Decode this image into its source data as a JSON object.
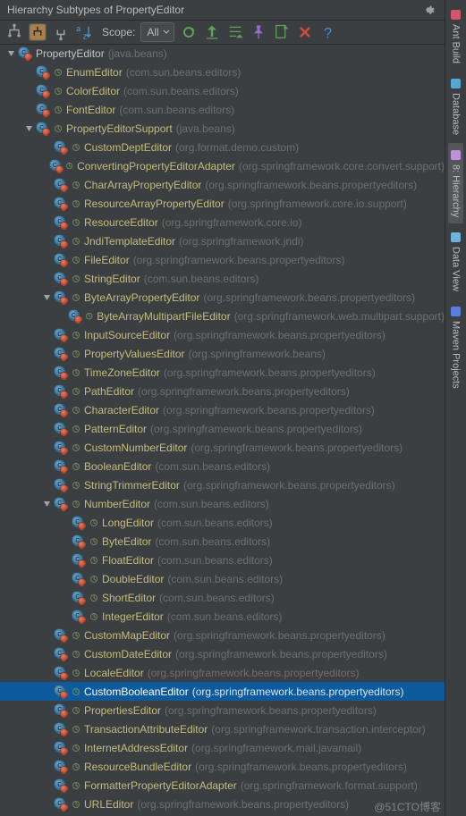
{
  "header": {
    "title": "Hierarchy Subtypes of PropertyEditor"
  },
  "toolbar": {
    "scope_label": "Scope:",
    "scope_value": "All"
  },
  "right_strip": {
    "tabs": [
      {
        "label": "Ant Build",
        "color": "#d2576d"
      },
      {
        "label": "Database",
        "color": "#57a8d8"
      },
      {
        "label": "8: Hierarchy",
        "color": "#c28fdc",
        "hl": true
      },
      {
        "label": "Data View",
        "color": "#6fb2de"
      },
      {
        "label": "Maven Projects",
        "color": "#5a7fe0"
      }
    ]
  },
  "tree": {
    "rows": [
      {
        "d": 0,
        "arrow": "down",
        "root": true,
        "name": "PropertyEditor",
        "pkg": "(java.beans)"
      },
      {
        "d": 1,
        "name": "EnumEditor",
        "pkg": "(com.sun.beans.editors)"
      },
      {
        "d": 1,
        "name": "ColorEditor",
        "pkg": "(com.sun.beans.editors)"
      },
      {
        "d": 1,
        "name": "FontEditor",
        "pkg": "(com.sun.beans.editors)"
      },
      {
        "d": 1,
        "arrow": "down",
        "name": "PropertyEditorSupport",
        "pkg": "(java.beans)"
      },
      {
        "d": 2,
        "name": "CustomDeptEditor",
        "pkg": "(org.format.demo.custom)"
      },
      {
        "d": 2,
        "name": "ConvertingPropertyEditorAdapter",
        "pkg": "(org.springframework.core.convert.support)"
      },
      {
        "d": 2,
        "name": "CharArrayPropertyEditor",
        "pkg": "(org.springframework.beans.propertyeditors)"
      },
      {
        "d": 2,
        "name": "ResourceArrayPropertyEditor",
        "pkg": "(org.springframework.core.io.support)"
      },
      {
        "d": 2,
        "name": "ResourceEditor",
        "pkg": "(org.springframework.core.io)"
      },
      {
        "d": 2,
        "name": "JndiTemplateEditor",
        "pkg": "(org.springframework.jndi)"
      },
      {
        "d": 2,
        "name": "FileEditor",
        "pkg": "(org.springframework.beans.propertyeditors)"
      },
      {
        "d": 2,
        "name": "StringEditor",
        "pkg": "(com.sun.beans.editors)"
      },
      {
        "d": 2,
        "arrow": "down",
        "name": "ByteArrayPropertyEditor",
        "pkg": "(org.springframework.beans.propertyeditors)"
      },
      {
        "d": 3,
        "name": "ByteArrayMultipartFileEditor",
        "pkg": "(org.springframework.web.multipart.support)"
      },
      {
        "d": 2,
        "name": "InputSourceEditor",
        "pkg": "(org.springframework.beans.propertyeditors)"
      },
      {
        "d": 2,
        "name": "PropertyValuesEditor",
        "pkg": "(org.springframework.beans)"
      },
      {
        "d": 2,
        "name": "TimeZoneEditor",
        "pkg": "(org.springframework.beans.propertyeditors)"
      },
      {
        "d": 2,
        "name": "PathEditor",
        "pkg": "(org.springframework.beans.propertyeditors)"
      },
      {
        "d": 2,
        "name": "CharacterEditor",
        "pkg": "(org.springframework.beans.propertyeditors)"
      },
      {
        "d": 2,
        "name": "PatternEditor",
        "pkg": "(org.springframework.beans.propertyeditors)"
      },
      {
        "d": 2,
        "name": "CustomNumberEditor",
        "pkg": "(org.springframework.beans.propertyeditors)"
      },
      {
        "d": 2,
        "name": "BooleanEditor",
        "pkg": "(com.sun.beans.editors)"
      },
      {
        "d": 2,
        "name": "StringTrimmerEditor",
        "pkg": "(org.springframework.beans.propertyeditors)"
      },
      {
        "d": 2,
        "arrow": "down",
        "name": "NumberEditor",
        "pkg": "(com.sun.beans.editors)"
      },
      {
        "d": 3,
        "name": "LongEditor",
        "pkg": "(com.sun.beans.editors)"
      },
      {
        "d": 3,
        "name": "ByteEditor",
        "pkg": "(com.sun.beans.editors)"
      },
      {
        "d": 3,
        "name": "FloatEditor",
        "pkg": "(com.sun.beans.editors)"
      },
      {
        "d": 3,
        "name": "DoubleEditor",
        "pkg": "(com.sun.beans.editors)"
      },
      {
        "d": 3,
        "name": "ShortEditor",
        "pkg": "(com.sun.beans.editors)"
      },
      {
        "d": 3,
        "name": "IntegerEditor",
        "pkg": "(com.sun.beans.editors)"
      },
      {
        "d": 2,
        "name": "CustomMapEditor",
        "pkg": "(org.springframework.beans.propertyeditors)"
      },
      {
        "d": 2,
        "name": "CustomDateEditor",
        "pkg": "(org.springframework.beans.propertyeditors)"
      },
      {
        "d": 2,
        "name": "LocaleEditor",
        "pkg": "(org.springframework.beans.propertyeditors)"
      },
      {
        "d": 2,
        "sel": true,
        "name": "CustomBooleanEditor",
        "pkg": "(org.springframework.beans.propertyeditors)"
      },
      {
        "d": 2,
        "name": "PropertiesEditor",
        "pkg": "(org.springframework.beans.propertyeditors)"
      },
      {
        "d": 2,
        "name": "TransactionAttributeEditor",
        "pkg": "(org.springframework.transaction.interceptor)"
      },
      {
        "d": 2,
        "name": "InternetAddressEditor",
        "pkg": "(org.springframework.mail.javamail)"
      },
      {
        "d": 2,
        "name": "ResourceBundleEditor",
        "pkg": "(org.springframework.beans.propertyeditors)"
      },
      {
        "d": 2,
        "name": "FormatterPropertyEditorAdapter",
        "pkg": "(org.springframework.format.support)"
      },
      {
        "d": 2,
        "name": "URLEditor",
        "pkg": "(org.springframework.beans.propertyeditors)"
      }
    ]
  },
  "watermark": "@51CTO博客"
}
